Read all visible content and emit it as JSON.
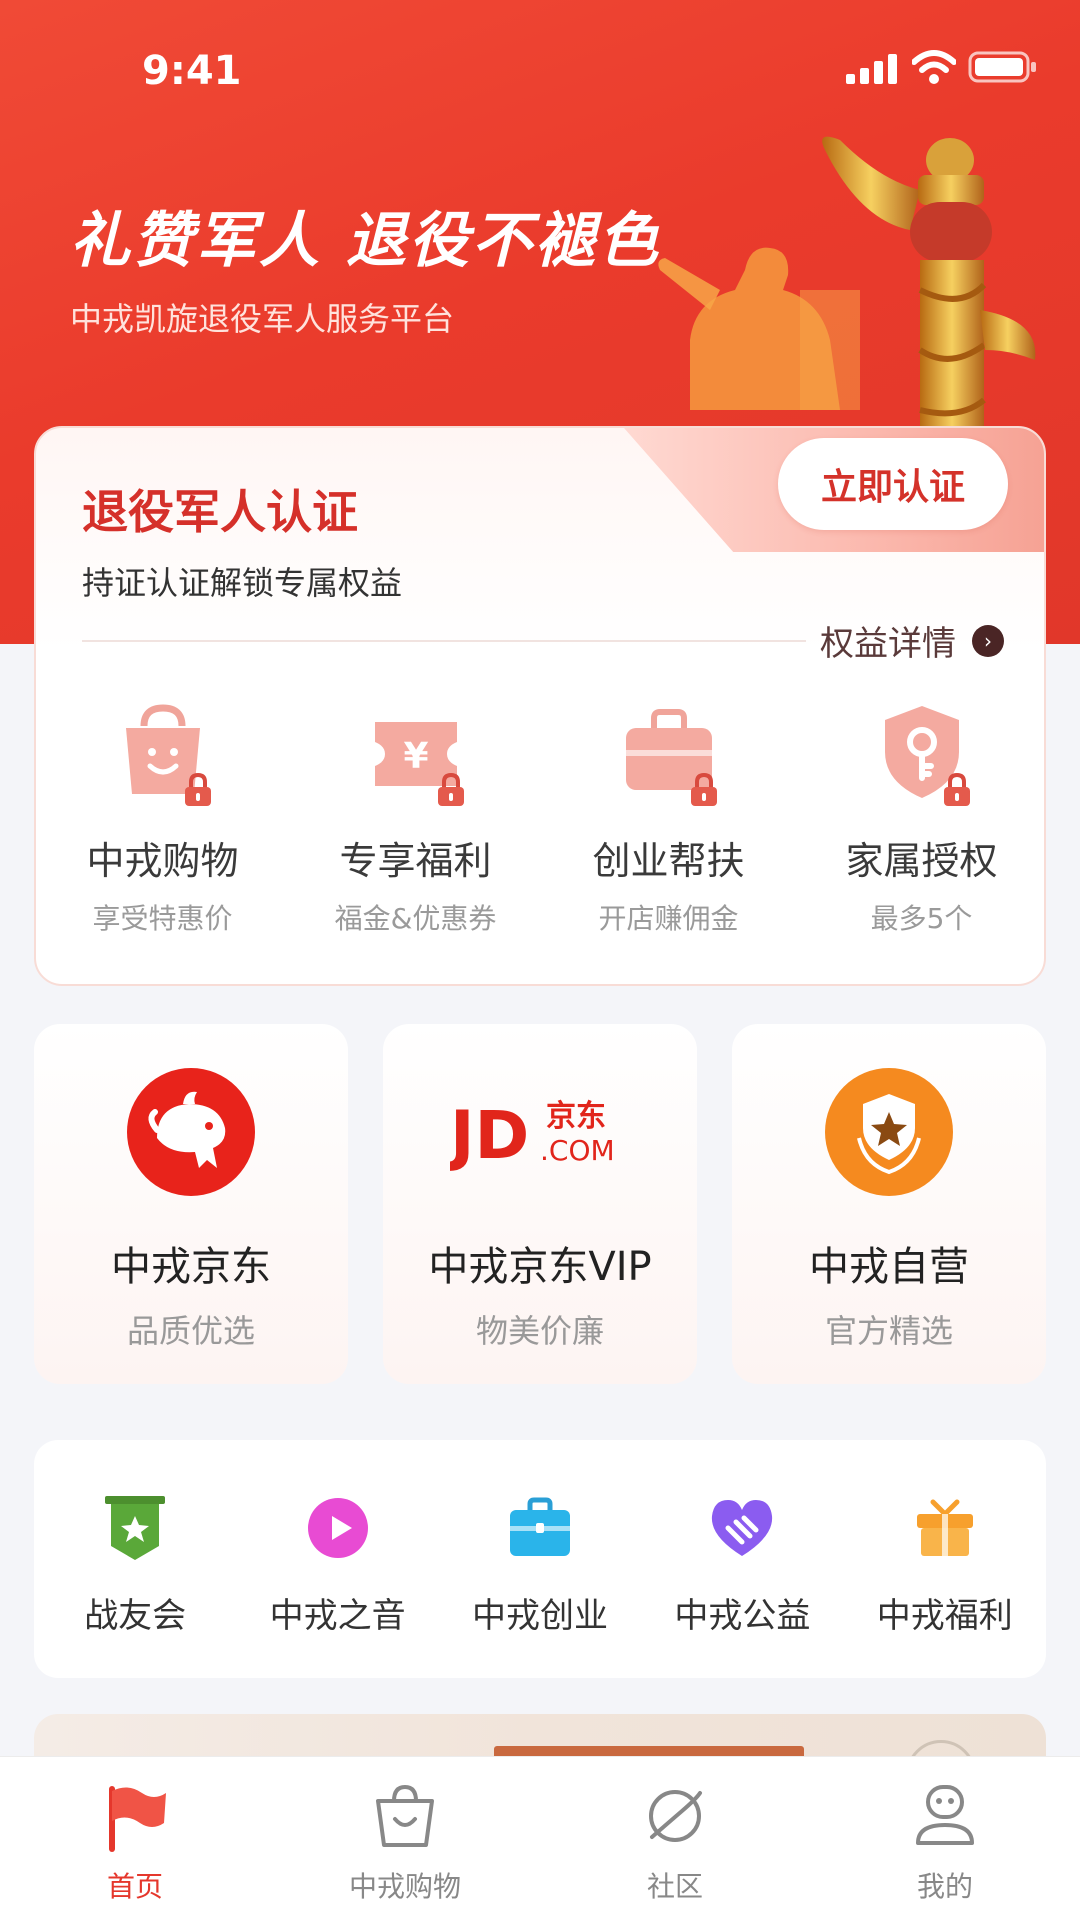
{
  "status_bar": {
    "time": "9:41"
  },
  "hero": {
    "title": "礼赞军人 退役不褪色",
    "subtitle": "中戎凯旋退役军人服务平台"
  },
  "cert": {
    "title": "退役军人认证",
    "desc": "持证认证解锁专属权益",
    "button": "立即认证",
    "link": "权益详情",
    "benefits": [
      {
        "name": "中戎购物",
        "sub": "享受特惠价",
        "icon": "shopping-bag-icon"
      },
      {
        "name": "专享福利",
        "sub": "福金&优惠券",
        "icon": "coupon-icon"
      },
      {
        "name": "创业帮扶",
        "sub": "开店赚佣金",
        "icon": "briefcase-icon"
      },
      {
        "name": "家属授权",
        "sub": "最多5个",
        "icon": "key-shield-icon"
      }
    ]
  },
  "stores": [
    {
      "name": "中戎京东",
      "sub": "品质优选",
      "icon": "jd-dog-logo"
    },
    {
      "name": "中戎京东VIP",
      "sub": "物美价廉",
      "icon": "jd-com-logo",
      "logo_text_left": "JD",
      "logo_text_top": "京东",
      "logo_text_bottom": ".COM"
    },
    {
      "name": "中戎自营",
      "sub": "官方精选",
      "icon": "star-badge-logo"
    }
  ],
  "quick": [
    {
      "label": "战友会",
      "icon": "banner-star-icon",
      "color": "#5aa839"
    },
    {
      "label": "中戎之音",
      "icon": "play-icon",
      "color": "#e84bd3"
    },
    {
      "label": "中戎创业",
      "icon": "briefcase-icon",
      "color": "#2ab4ea"
    },
    {
      "label": "中戎公益",
      "icon": "heart-hands-icon",
      "color": "#8b5cf0"
    },
    {
      "label": "中戎福利",
      "icon": "gift-icon",
      "color": "#f7a02d"
    }
  ],
  "tabbar": [
    {
      "label": "首页",
      "icon": "flag-icon",
      "active": true
    },
    {
      "label": "中戎购物",
      "icon": "basket-icon",
      "active": false
    },
    {
      "label": "社区",
      "icon": "planet-icon",
      "active": false
    },
    {
      "label": "我的",
      "icon": "person-icon",
      "active": false
    }
  ],
  "colors": {
    "brand_red": "#e5372c",
    "hero_red": "#ea3b2c"
  }
}
